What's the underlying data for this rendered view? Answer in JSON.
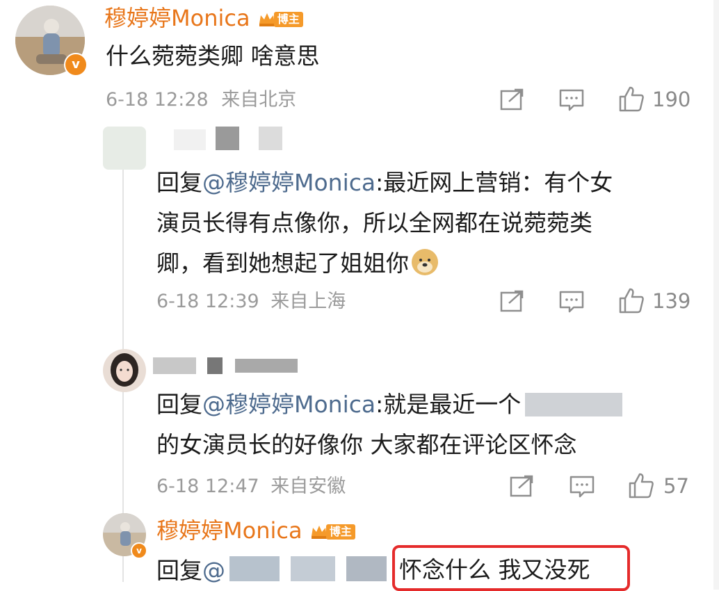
{
  "comment": {
    "author": "穆婷婷Monica",
    "badge": "博主",
    "text": "什么菀菀类卿 啥意思",
    "time": "6-18 12:28",
    "location": "来自北京",
    "likes": "190"
  },
  "replies": [
    {
      "author_hidden": true,
      "prefix": "回复",
      "mention": "@穆婷婷Monica",
      "text_lines": [
        ":最近网上营销：有个女",
        "演员长得有点像你，所以全网都在说菀菀类",
        "卿，看到她想起了姐姐你"
      ],
      "emoji": "doge-emoji",
      "time": "6-18 12:39",
      "location": "来自上海",
      "likes": "139"
    },
    {
      "author_hidden": true,
      "prefix": "回复",
      "mention": "@穆婷婷Monica",
      "text_lines": [
        ":就是最近一个",
        "的女演员长的好像你  大家都在评论区怀念"
      ],
      "time": "6-18 12:47",
      "location": "来自安徽",
      "likes": "57"
    },
    {
      "author": "穆婷婷Monica",
      "badge": "博主",
      "prefix": "回复",
      "mention": "@",
      "highlighted_text": "怀念什么 我又没死"
    }
  ],
  "colors": {
    "accent": "#e8761a",
    "mention": "#4e6b8e",
    "highlight_border": "#e52b2b",
    "meta": "#9a9a9a"
  }
}
